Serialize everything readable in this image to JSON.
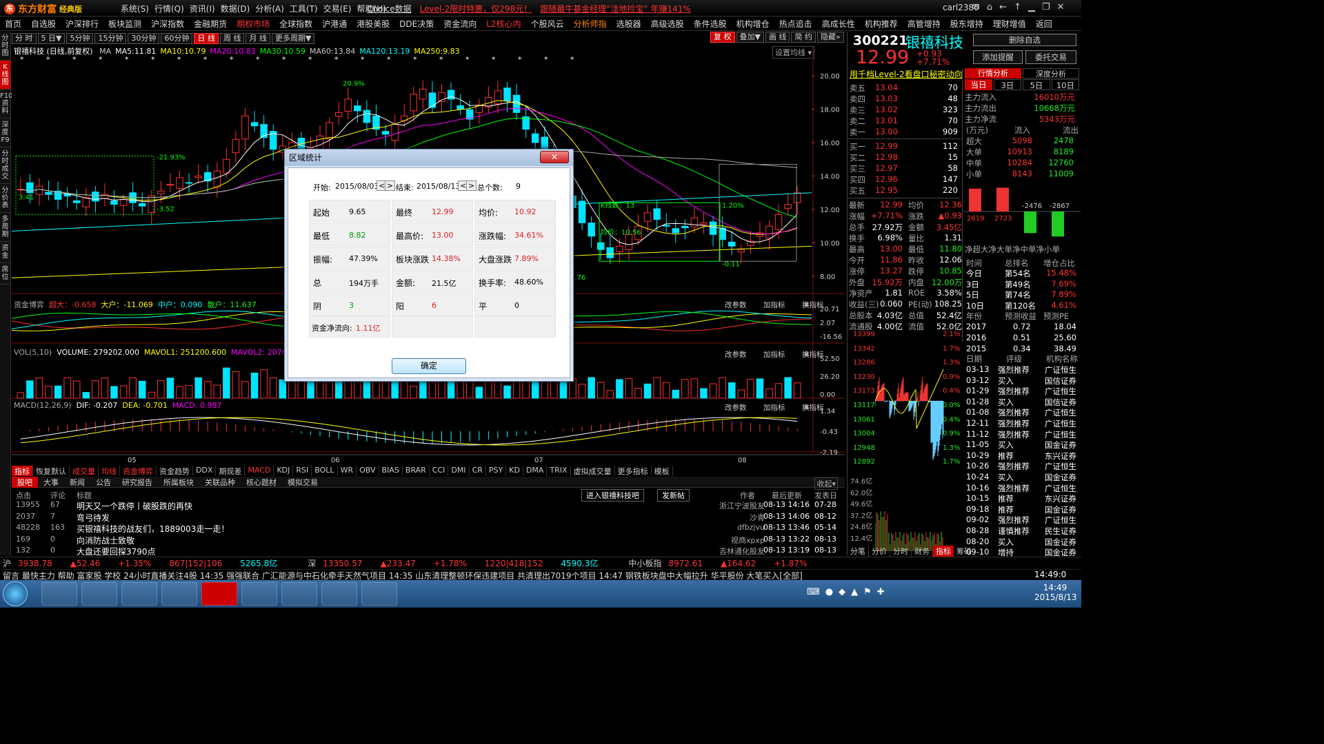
{
  "title_bar": {
    "brand": "东方财富",
    "brand_sub": "经典版",
    "menus": [
      "系统(S)",
      "行情(Q)",
      "资讯(I)",
      "数据(D)",
      "分析(A)",
      "工具(T)",
      "交易(E)",
      "帮助(H)"
    ],
    "promo1": "Choice数据",
    "promo2": "Level-2限时特惠，仅298元！",
    "promo3": "跟随最牛基金经理“洼地捡宝” 年赚141%",
    "user": "carl2380"
  },
  "nav": [
    "首页",
    "自选股",
    "沪深排行",
    "板块监测",
    "沪深指数",
    "金融期货",
    "期权市场",
    "全球指数",
    "沪港通",
    "港股美股",
    "DDE决策",
    "资金流向",
    "L2核心内",
    "个股风云",
    "分析师指",
    "选股器",
    "高级选股",
    "条件选股",
    "机构增仓",
    "热点追击",
    "高成长性",
    "机构推荐",
    "高管增持",
    "股东增持",
    "理财增值",
    "返回"
  ],
  "side_tabs": [
    "分时图",
    "K线图",
    "F10资料",
    "深度F9",
    "分时成交",
    "分价表",
    "多周期",
    "资金",
    "席位"
  ],
  "period_buttons": [
    "分 时",
    "5 日▼",
    "5分钟",
    "15分钟",
    "30分钟",
    "60分钟",
    "日 线",
    "周 线",
    "月 线",
    "更多周期▼"
  ],
  "right_buttons": [
    "复 权",
    "叠加▼",
    "画 线",
    "简 约",
    "隐藏»"
  ],
  "kline": {
    "name": "银禧科技 (日线,前复权)",
    "ma": [
      {
        "label": "MA",
        "value": "",
        "color": "#ccc"
      },
      {
        "label": "MA5:",
        "value": "11.81",
        "color": "#fff"
      },
      {
        "label": "MA10:",
        "value": "10.79",
        "color": "#ff0"
      },
      {
        "label": "MA20:",
        "value": "10.83",
        "color": "#f0f"
      },
      {
        "label": "MA30:",
        "value": "10.59",
        "color": "#0f0"
      },
      {
        "label": "MA60:",
        "value": "13.84",
        "color": "#ccc"
      },
      {
        "label": "MA120:",
        "value": "13.19",
        "color": "#0ff"
      },
      {
        "label": "MA250:",
        "value": "9.83",
        "color": "#ff0"
      }
    ],
    "setting": "设置均线 ▾",
    "price_axis": [
      "20.00",
      "18.00",
      "16.00",
      "14.00",
      "12.00",
      "10.00",
      "8.00"
    ],
    "box_labels": [
      "-21.93%",
      "-3.52",
      "3.41",
      "K线数：13",
      "均价：10.56",
      "1.20%",
      "-0.11",
      "20.9%",
      "7.76"
    ]
  },
  "capital_game": {
    "title": "资金博弈",
    "super": "超大：-0.658",
    "big": "大户：-11.069",
    "mid": "中户：0.090",
    "small": "散户：11.637",
    "axis": [
      "20.71",
      "2.07",
      "-16.56"
    ]
  },
  "volume": {
    "title": "VOL(5,10)",
    "vol": "VOLUME: 279202.000",
    "mavol1": "MAVOL1: 251200.600",
    "mavol2": "MAVOL2: 207671.900",
    "axis": [
      "52.50",
      "26.20",
      "0.00"
    ]
  },
  "macd": {
    "title": "MACD(12,26,9)",
    "dif": "DIF: -0.207",
    "dea": "DEA: -0.701",
    "macd": "MACD: 0.987",
    "axis": [
      "1.34",
      "-0.43",
      "-2.19"
    ]
  },
  "panel_buttons": [
    "改参数",
    "加指标",
    "换指标"
  ],
  "time_axis": [
    "05",
    "06",
    "07",
    "08"
  ],
  "dialog": {
    "title": "区域统计",
    "start_label": "开始:",
    "start": "2015/08/03",
    "end_label": "结束:",
    "end": "2015/08/13",
    "count_label": "总个数:",
    "count": "9",
    "cells": [
      {
        "label": "起始",
        "value": "9.65",
        "color": "#000"
      },
      {
        "label": "最终",
        "value": "12.99",
        "color": "#d22"
      },
      {
        "label": "均价:",
        "value": "10.92",
        "color": "#d22"
      },
      {
        "label": "最低",
        "value": "8.82",
        "color": "#090"
      },
      {
        "label": "最高价:",
        "value": "13.00",
        "color": "#d22"
      },
      {
        "label": "涨跌幅:",
        "value": "34.61%",
        "color": "#d22"
      },
      {
        "label": "振幅:",
        "value": "47.39%",
        "color": "#000"
      },
      {
        "label": "板块涨跌",
        "value": "14.38%",
        "color": "#d22"
      },
      {
        "label": "大盘涨跌",
        "value": "7.89%",
        "color": "#d22"
      },
      {
        "label": "总",
        "value": "194万手",
        "color": "#000"
      },
      {
        "label": "金额:",
        "value": "21.5亿",
        "color": "#000"
      },
      {
        "label": "换手率:",
        "value": "48.60%",
        "color": "#000"
      },
      {
        "label": "阴",
        "value": "3",
        "color": "#090"
      },
      {
        "label": "阳",
        "value": "6",
        "color": "#d22"
      },
      {
        "label": "平",
        "value": "0",
        "color": "#000"
      }
    ],
    "flow_label": "资金净流向:",
    "flow_value": "1.11亿",
    "ok": "确定"
  },
  "bottom_tabs": [
    "指标",
    "恢复默认",
    "成交量",
    "均线",
    "资金博弈",
    "资金趋势",
    "DDX",
    "期现差",
    "MACD",
    "KDJ",
    "RSI",
    "BOLL",
    "WR",
    "OBV",
    "BIAS",
    "BRAR",
    "CCI",
    "DMI",
    "CR",
    "PSY",
    "KD",
    "DMA",
    "TRIX",
    "虚拟成交量",
    "更多指标",
    "模板"
  ],
  "news_tabs": [
    "股吧",
    "大事",
    "新闻",
    "公告",
    "研究报告",
    "所属板块",
    "关联品种",
    "核心题材",
    "模拟交易"
  ],
  "news_head": {
    "clicks": "点击",
    "replies": "评论",
    "title": "标题",
    "author": "作者",
    "updated": "最后更新",
    "posted": "发表日",
    "enter": "进入银禧科技吧",
    "post": "发新帖",
    "collapse": "收起▾"
  },
  "news": [
    {
      "clicks": "13955",
      "replies": "67",
      "title": "明天又一个跌停丨破股跌的再快",
      "author": "浙江宁波股友",
      "updated": "08-13 14:16",
      "posted": "07-28"
    },
    {
      "clicks": "2037",
      "replies": "7",
      "title": "弯弓待发",
      "author": "沙青",
      "updated": "08-13 14:06",
      "posted": "08-12"
    },
    {
      "clicks": "48228",
      "replies": "163",
      "title": "买银禧科技的战友们，1889003走一走！",
      "author": "dfbzjvu",
      "updated": "08-13 13:46",
      "posted": "05-14"
    },
    {
      "clicks": "169",
      "replies": "0",
      "title": "向消防战士致敬",
      "author": "视商xpxp",
      "updated": "08-13 13:22",
      "posted": "08-13"
    },
    {
      "clicks": "132",
      "replies": "0",
      "title": "大盘还要回探3790点",
      "author": "吉林通化股友",
      "updated": "08-13 13:19",
      "posted": "08-13"
    }
  ],
  "quote": {
    "code": "300221",
    "name": "银禧科技",
    "price": "12.99",
    "change": "+0.93",
    "pct": "+7.71%",
    "btn_del": "删除自选",
    "btn_alert": "添加提醒",
    "btn_trade": "委托交易",
    "level2": "用千档Level-2看盘口秘密动向",
    "asks": [
      {
        "label": "卖五",
        "price": "13.04",
        "vol": "70"
      },
      {
        "label": "卖四",
        "price": "13.03",
        "vol": "48"
      },
      {
        "label": "卖三",
        "price": "13.02",
        "vol": "323"
      },
      {
        "label": "卖二",
        "price": "13.01",
        "vol": "70"
      },
      {
        "label": "卖一",
        "price": "13.00",
        "vol": "909"
      }
    ],
    "bids": [
      {
        "label": "买一",
        "price": "12.99",
        "vol": "112"
      },
      {
        "label": "买二",
        "price": "12.98",
        "vol": "15"
      },
      {
        "label": "买三",
        "price": "12.97",
        "vol": "58"
      },
      {
        "label": "买四",
        "price": "12.96",
        "vol": "147"
      },
      {
        "label": "买五",
        "price": "12.95",
        "vol": "220"
      }
    ],
    "stats": [
      [
        "最新",
        "12.99",
        "均价",
        "12.36"
      ],
      [
        "涨幅",
        "+7.71%",
        "涨跌",
        "▲0.93"
      ],
      [
        "总手",
        "27.92万",
        "金额",
        "3.45亿"
      ],
      [
        "换手",
        "6.98%",
        "量比",
        "1.31"
      ],
      [
        "最高",
        "13.00",
        "最低",
        "11.80"
      ],
      [
        "今开",
        "11.86",
        "昨收",
        "12.06"
      ],
      [
        "涨停",
        "13.27",
        "跌停",
        "10.85"
      ],
      [
        "外盘",
        "15.92万",
        "内盘",
        "12.00万"
      ],
      [
        "净资产",
        "1.81",
        "ROE",
        "3.58%"
      ],
      [
        "收益(三)",
        "0.060",
        "PE(动)",
        "108.25"
      ],
      [
        "总股本",
        "4.03亿",
        "总值",
        "52.4亿"
      ],
      [
        "流通股",
        "4.00亿",
        "流值",
        "52.0亿"
      ]
    ]
  },
  "flow": {
    "tabs": [
      "行情分析",
      "深度分析"
    ],
    "days": [
      "当日",
      "3日",
      "5日",
      "10日"
    ],
    "main_in_label": "主力流入",
    "main_in": "16010万元",
    "main_out_label": "主力流出",
    "main_out": "10668万元",
    "main_net_label": "主力净流",
    "main_net": "5343万元",
    "head": [
      "(万元)",
      "流入",
      "流出"
    ],
    "rows": [
      [
        "超大",
        "5098",
        "2478"
      ],
      [
        "大单",
        "10913",
        "8189"
      ],
      [
        "中单",
        "10284",
        "12760"
      ],
      [
        "小单",
        "8143",
        "11009"
      ]
    ],
    "bars": [
      "2619",
      "2723",
      "-2476",
      "-2867"
    ],
    "bar_labels": "净超大净大单净中单净小单",
    "rank_head": [
      "时间",
      "总排名",
      "增仓占比"
    ],
    "ranks": [
      [
        "今日",
        "第54名",
        "15.48%"
      ],
      [
        "3日",
        "第49名",
        "7.69%"
      ],
      [
        "5日",
        "第74名",
        "7.89%"
      ],
      [
        "10日",
        "第120名",
        "4.61%"
      ]
    ],
    "eps_head": [
      "年份",
      "预测收益",
      "预测PE"
    ],
    "eps": [
      [
        "2017",
        "0.72",
        "18.04"
      ],
      [
        "2016",
        "0.51",
        "25.60"
      ],
      [
        "2015",
        "0.34",
        "38.49"
      ]
    ],
    "rate_head": [
      "日期",
      "评级",
      "机构名称"
    ],
    "ratings": [
      [
        "03-13",
        "强烈推荐",
        "广证恒生"
      ],
      [
        "03-12",
        "买入",
        "国信证券"
      ],
      [
        "01-29",
        "强烈推荐",
        "广证恒生"
      ],
      [
        "01-28",
        "买入",
        "国信证券"
      ],
      [
        "01-08",
        "强烈推荐",
        "广证恒生"
      ],
      [
        "12-11",
        "强烈推荐",
        "广证恒生"
      ],
      [
        "11-12",
        "强烈推荐",
        "广证恒生"
      ],
      [
        "11-05",
        "买入",
        "国金证券"
      ],
      [
        "10-29",
        "推荐",
        "东兴证券"
      ],
      [
        "10-26",
        "强烈推荐",
        "广证恒生"
      ],
      [
        "10-24",
        "买入",
        "国金证券"
      ],
      [
        "10-16",
        "强烈推荐",
        "广证恒生"
      ],
      [
        "10-15",
        "推荐",
        "东兴证券"
      ],
      [
        "09-18",
        "推荐",
        "国金证券"
      ],
      [
        "09-02",
        "强烈推荐",
        "广证恒生"
      ],
      [
        "08-28",
        "谨慎推荐",
        "民生证券"
      ],
      [
        "08-20",
        "买入",
        "国金证券"
      ],
      [
        "09-10",
        "增持",
        "国金证券"
      ]
    ]
  },
  "mini_axis_left": [
    "13399",
    "13342",
    "13286",
    "13230",
    "13173",
    "13117",
    "13061",
    "13004",
    "12948",
    "12892"
  ],
  "mini_axis_right": [
    "2.1%",
    "1.7%",
    "1.3%",
    "0.9%",
    "0.4%",
    "0.0%",
    "0.4%",
    "0.9%",
    "1.3%",
    "1.7%"
  ],
  "mini_vol_axis": [
    "74.6亿",
    "62.0亿",
    "49.6亿",
    "37.2亿",
    "24.8亿",
    "12.4亿"
  ],
  "mini_tabs": [
    "分笔",
    "分价",
    "分时",
    "财务",
    "指标",
    "筹码"
  ],
  "status": [
    {
      "t": "沪",
      "c": "#ccc"
    },
    {
      "t": "3938.78",
      "c": "#f33"
    },
    {
      "t": "▲52.46",
      "c": "#f33"
    },
    {
      "t": "+1.35%",
      "c": "#f33"
    },
    {
      "t": "867|152|106",
      "c": "#f33"
    },
    {
      "t": "5265.8亿",
      "c": "#0ff"
    },
    {
      "t": "深",
      "c": "#ccc"
    },
    {
      "t": "13350.57",
      "c": "#f33"
    },
    {
      "t": "▲233.47",
      "c": "#f33"
    },
    {
      "t": "+1.78%",
      "c": "#f33"
    },
    {
      "t": "1220|418|152",
      "c": "#f33"
    },
    {
      "t": "4590.3亿",
      "c": "#0ff"
    },
    {
      "t": "中小板指",
      "c": "#ccc"
    },
    {
      "t": "8972.61",
      "c": "#f33"
    },
    {
      "t": "▲164.62",
      "c": "#f33"
    },
    {
      "t": "+1.87%",
      "c": "#f33"
    }
  ],
  "ticker": "留言  最快主力  帮助  富家股  学校  24小时直播关注4股  14:35 强强联合 广汇能源与中石化牵手天然气项目  14:35 山东清理整顿环保违建项目 共清理出7019个项目  14:47 钢铁板块盘中大幅拉升  华平股份 大笔买入[全部]",
  "clock": "14:49:0",
  "taskbar": {
    "time": "14:49",
    "date": "2015/8/13"
  }
}
